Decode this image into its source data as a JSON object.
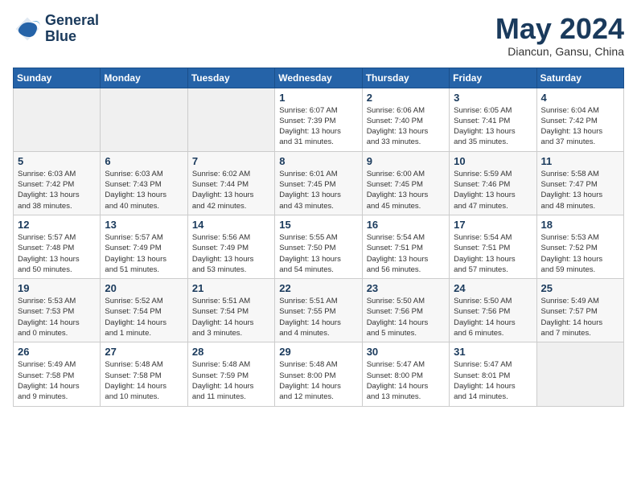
{
  "header": {
    "logo_line1": "General",
    "logo_line2": "Blue",
    "month_title": "May 2024",
    "location": "Diancun, Gansu, China"
  },
  "days_of_week": [
    "Sunday",
    "Monday",
    "Tuesday",
    "Wednesday",
    "Thursday",
    "Friday",
    "Saturday"
  ],
  "weeks": [
    [
      {
        "day": "",
        "info": ""
      },
      {
        "day": "",
        "info": ""
      },
      {
        "day": "",
        "info": ""
      },
      {
        "day": "1",
        "info": "Sunrise: 6:07 AM\nSunset: 7:39 PM\nDaylight: 13 hours\nand 31 minutes."
      },
      {
        "day": "2",
        "info": "Sunrise: 6:06 AM\nSunset: 7:40 PM\nDaylight: 13 hours\nand 33 minutes."
      },
      {
        "day": "3",
        "info": "Sunrise: 6:05 AM\nSunset: 7:41 PM\nDaylight: 13 hours\nand 35 minutes."
      },
      {
        "day": "4",
        "info": "Sunrise: 6:04 AM\nSunset: 7:42 PM\nDaylight: 13 hours\nand 37 minutes."
      }
    ],
    [
      {
        "day": "5",
        "info": "Sunrise: 6:03 AM\nSunset: 7:42 PM\nDaylight: 13 hours\nand 38 minutes."
      },
      {
        "day": "6",
        "info": "Sunrise: 6:03 AM\nSunset: 7:43 PM\nDaylight: 13 hours\nand 40 minutes."
      },
      {
        "day": "7",
        "info": "Sunrise: 6:02 AM\nSunset: 7:44 PM\nDaylight: 13 hours\nand 42 minutes."
      },
      {
        "day": "8",
        "info": "Sunrise: 6:01 AM\nSunset: 7:45 PM\nDaylight: 13 hours\nand 43 minutes."
      },
      {
        "day": "9",
        "info": "Sunrise: 6:00 AM\nSunset: 7:45 PM\nDaylight: 13 hours\nand 45 minutes."
      },
      {
        "day": "10",
        "info": "Sunrise: 5:59 AM\nSunset: 7:46 PM\nDaylight: 13 hours\nand 47 minutes."
      },
      {
        "day": "11",
        "info": "Sunrise: 5:58 AM\nSunset: 7:47 PM\nDaylight: 13 hours\nand 48 minutes."
      }
    ],
    [
      {
        "day": "12",
        "info": "Sunrise: 5:57 AM\nSunset: 7:48 PM\nDaylight: 13 hours\nand 50 minutes."
      },
      {
        "day": "13",
        "info": "Sunrise: 5:57 AM\nSunset: 7:49 PM\nDaylight: 13 hours\nand 51 minutes."
      },
      {
        "day": "14",
        "info": "Sunrise: 5:56 AM\nSunset: 7:49 PM\nDaylight: 13 hours\nand 53 minutes."
      },
      {
        "day": "15",
        "info": "Sunrise: 5:55 AM\nSunset: 7:50 PM\nDaylight: 13 hours\nand 54 minutes."
      },
      {
        "day": "16",
        "info": "Sunrise: 5:54 AM\nSunset: 7:51 PM\nDaylight: 13 hours\nand 56 minutes."
      },
      {
        "day": "17",
        "info": "Sunrise: 5:54 AM\nSunset: 7:51 PM\nDaylight: 13 hours\nand 57 minutes."
      },
      {
        "day": "18",
        "info": "Sunrise: 5:53 AM\nSunset: 7:52 PM\nDaylight: 13 hours\nand 59 minutes."
      }
    ],
    [
      {
        "day": "19",
        "info": "Sunrise: 5:53 AM\nSunset: 7:53 PM\nDaylight: 14 hours\nand 0 minutes."
      },
      {
        "day": "20",
        "info": "Sunrise: 5:52 AM\nSunset: 7:54 PM\nDaylight: 14 hours\nand 1 minute."
      },
      {
        "day": "21",
        "info": "Sunrise: 5:51 AM\nSunset: 7:54 PM\nDaylight: 14 hours\nand 3 minutes."
      },
      {
        "day": "22",
        "info": "Sunrise: 5:51 AM\nSunset: 7:55 PM\nDaylight: 14 hours\nand 4 minutes."
      },
      {
        "day": "23",
        "info": "Sunrise: 5:50 AM\nSunset: 7:56 PM\nDaylight: 14 hours\nand 5 minutes."
      },
      {
        "day": "24",
        "info": "Sunrise: 5:50 AM\nSunset: 7:56 PM\nDaylight: 14 hours\nand 6 minutes."
      },
      {
        "day": "25",
        "info": "Sunrise: 5:49 AM\nSunset: 7:57 PM\nDaylight: 14 hours\nand 7 minutes."
      }
    ],
    [
      {
        "day": "26",
        "info": "Sunrise: 5:49 AM\nSunset: 7:58 PM\nDaylight: 14 hours\nand 9 minutes."
      },
      {
        "day": "27",
        "info": "Sunrise: 5:48 AM\nSunset: 7:58 PM\nDaylight: 14 hours\nand 10 minutes."
      },
      {
        "day": "28",
        "info": "Sunrise: 5:48 AM\nSunset: 7:59 PM\nDaylight: 14 hours\nand 11 minutes."
      },
      {
        "day": "29",
        "info": "Sunrise: 5:48 AM\nSunset: 8:00 PM\nDaylight: 14 hours\nand 12 minutes."
      },
      {
        "day": "30",
        "info": "Sunrise: 5:47 AM\nSunset: 8:00 PM\nDaylight: 14 hours\nand 13 minutes."
      },
      {
        "day": "31",
        "info": "Sunrise: 5:47 AM\nSunset: 8:01 PM\nDaylight: 14 hours\nand 14 minutes."
      },
      {
        "day": "",
        "info": ""
      }
    ]
  ]
}
